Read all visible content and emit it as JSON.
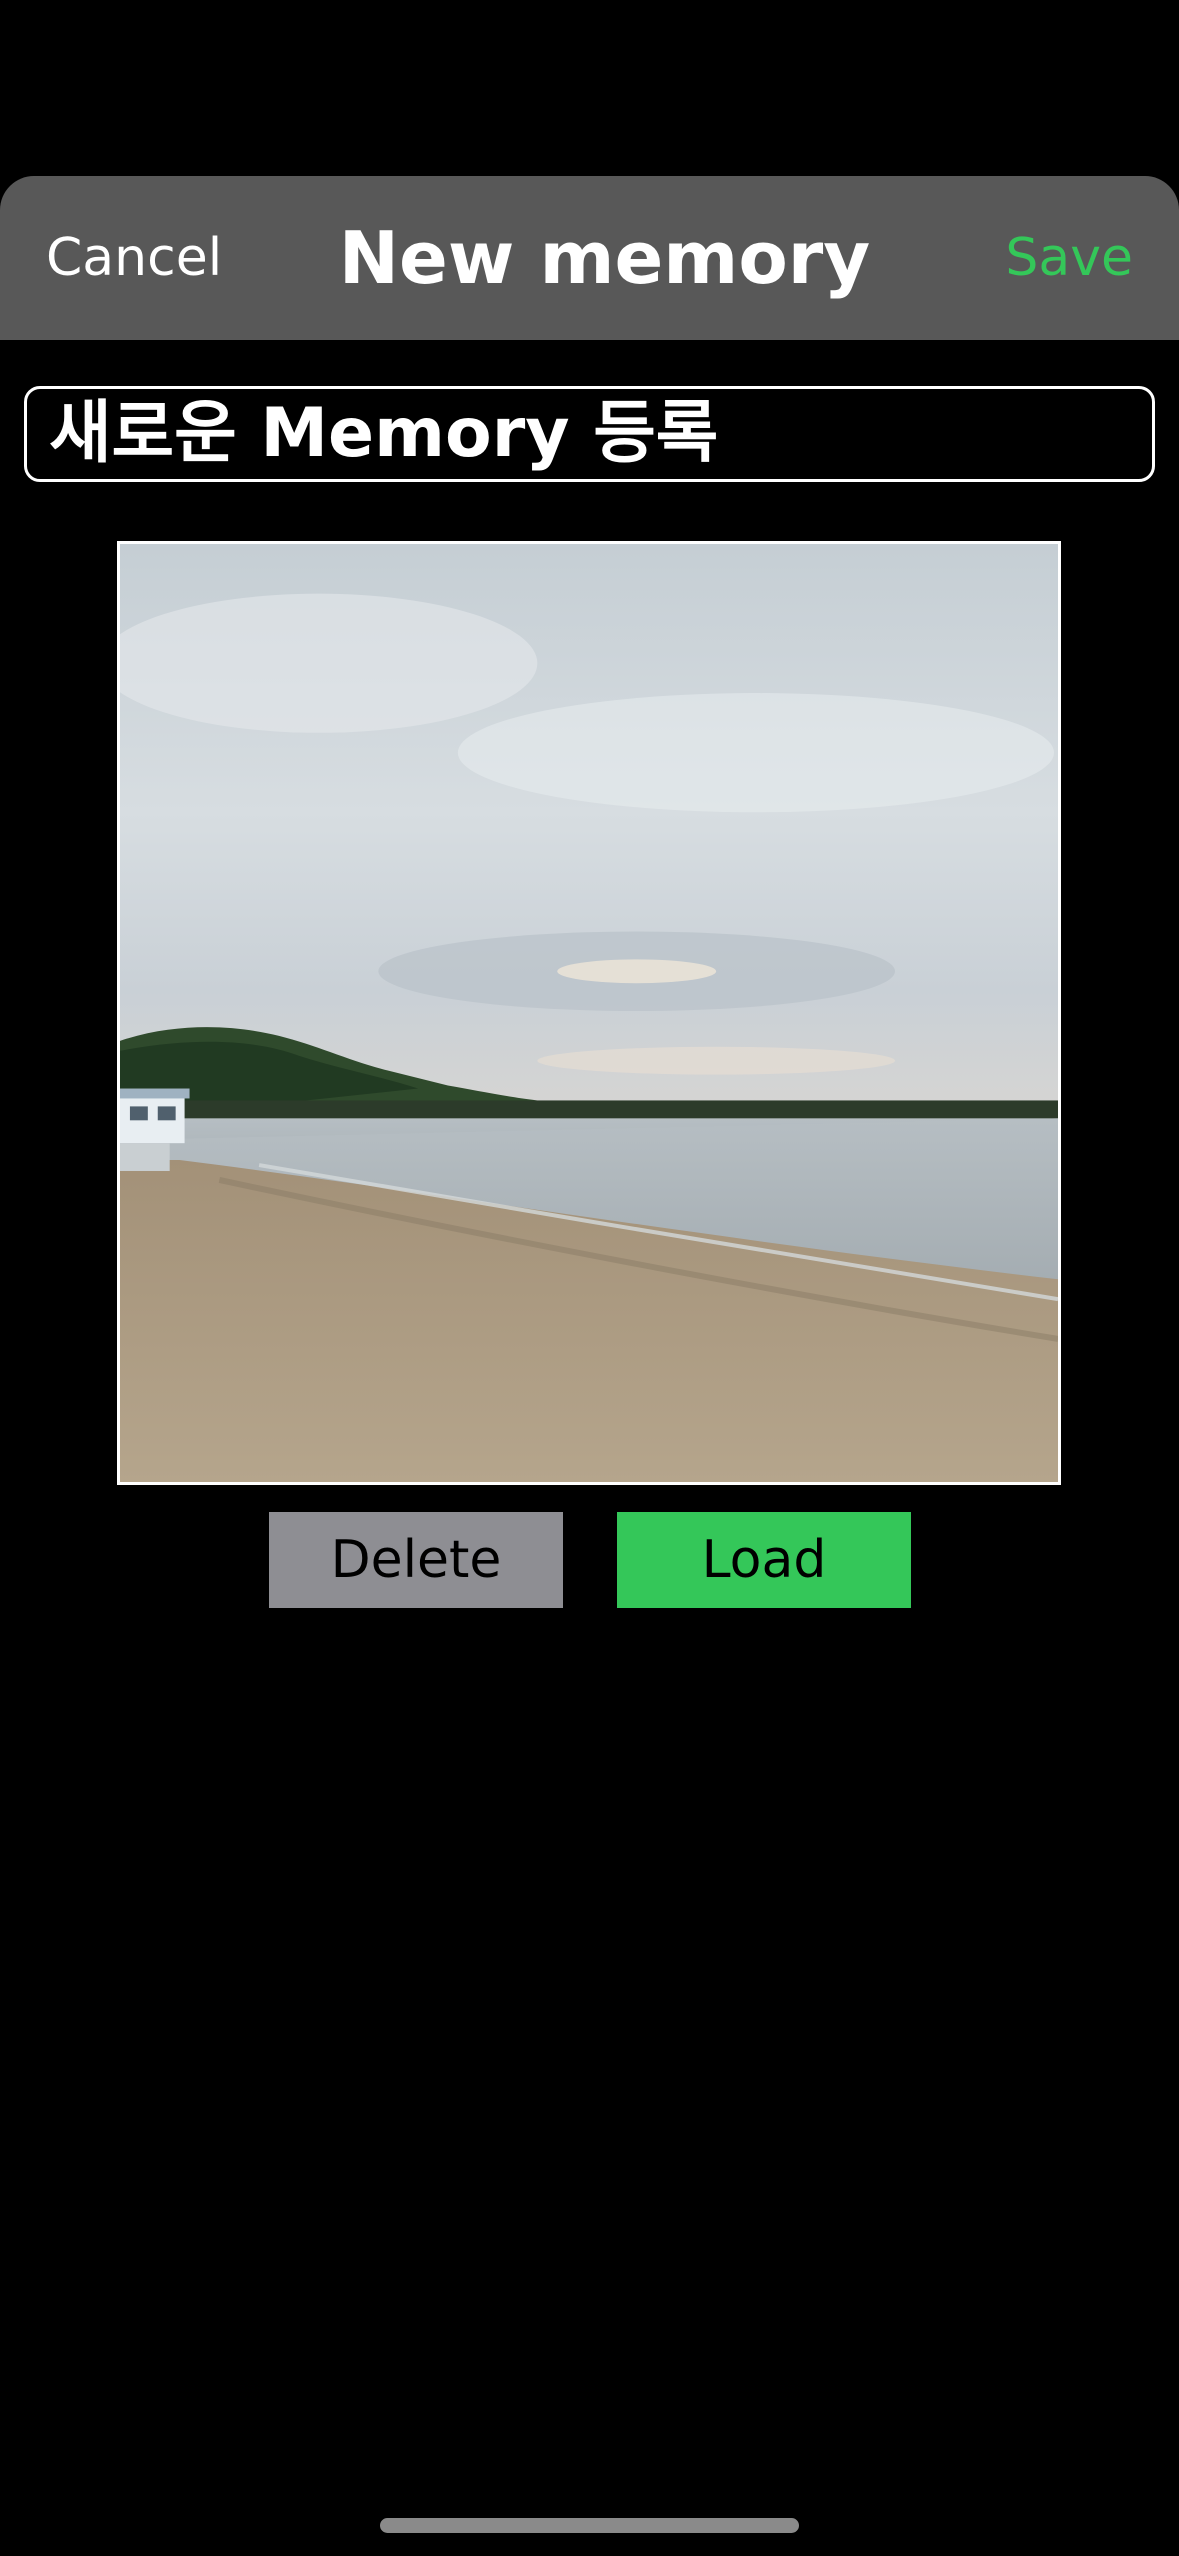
{
  "header": {
    "cancel_label": "Cancel",
    "title": "New memory",
    "save_label": "Save"
  },
  "title_field": {
    "value": "새로운 Memory 등록"
  },
  "photo": {
    "description_icon": "beach-photo"
  },
  "actions": {
    "delete_label": "Delete",
    "load_label": "Load"
  },
  "colors": {
    "accent": "#34c759",
    "header_bg": "#585858",
    "delete_bg": "#8e8e93",
    "background": "#000000"
  }
}
